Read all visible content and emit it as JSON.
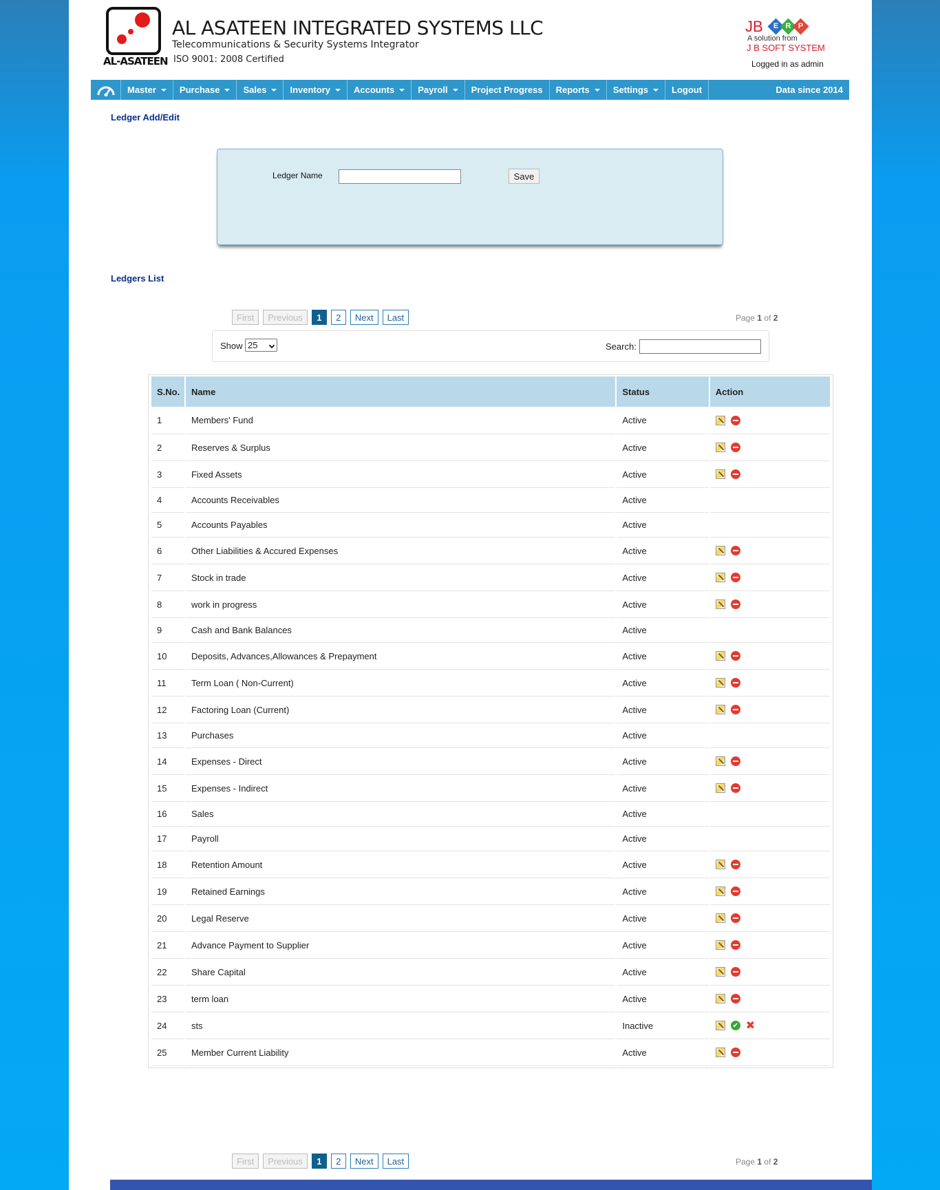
{
  "header": {
    "logo_word": "AL-ASATEEN",
    "company_name": "AL ASATEEN INTEGRATED SYSTEMS LLC",
    "tagline": "Telecommunications & Security Systems Integrator",
    "iso": "ISO 9001: 2008 Certified",
    "vendor_logo": {
      "jb": "JB",
      "e": "E",
      "r": "R",
      "p": "P",
      "solution_line": "A solution from",
      "vendor_name": "J B SOFT SYSTEM"
    },
    "logged_in": "Logged in as admin"
  },
  "nav": {
    "home_icon": "dashboard-gauge-icon",
    "items": [
      {
        "label": "Master",
        "dropdown": true
      },
      {
        "label": "Purchase",
        "dropdown": true
      },
      {
        "label": "Sales",
        "dropdown": true
      },
      {
        "label": "Inventory",
        "dropdown": true
      },
      {
        "label": "Accounts",
        "dropdown": true
      },
      {
        "label": "Payroll",
        "dropdown": true
      },
      {
        "label": "Project Progress",
        "dropdown": false
      },
      {
        "label": "Reports",
        "dropdown": true
      },
      {
        "label": "Settings",
        "dropdown": true
      },
      {
        "label": "Logout",
        "dropdown": false
      }
    ],
    "data_since": "Data since 2014"
  },
  "form": {
    "title": "Ledger Add/Edit",
    "ledger_name_label": "Ledger Name",
    "ledger_name_value": "",
    "save_label": "Save"
  },
  "list": {
    "title": "Ledgers List",
    "pager": {
      "first": "First",
      "previous": "Previous",
      "pages": [
        "1",
        "2"
      ],
      "current_page": "1",
      "next": "Next",
      "last": "Last",
      "page_word": "Page",
      "current": "1",
      "of_word": "of",
      "total": "2"
    },
    "show_label": "Show",
    "show_value": "25",
    "search_label": "Search:",
    "search_value": "",
    "columns": [
      "S.No.",
      "Name",
      "Status",
      "Action"
    ],
    "rows": [
      {
        "sn": "1",
        "name": "Members' Fund",
        "status": "Active",
        "actions": [
          "edit",
          "delete"
        ]
      },
      {
        "sn": "2",
        "name": "Reserves & Surplus",
        "status": "Active",
        "actions": [
          "edit",
          "delete"
        ]
      },
      {
        "sn": "3",
        "name": "Fixed Assets",
        "status": "Active",
        "actions": [
          "edit",
          "delete"
        ]
      },
      {
        "sn": "4",
        "name": "Accounts Receivables",
        "status": "Active",
        "actions": []
      },
      {
        "sn": "5",
        "name": "Accounts Payables",
        "status": "Active",
        "actions": []
      },
      {
        "sn": "6",
        "name": "Other Liabilities & Accured Expenses",
        "status": "Active",
        "actions": [
          "edit",
          "delete"
        ]
      },
      {
        "sn": "7",
        "name": "Stock in trade",
        "status": "Active",
        "actions": [
          "edit",
          "delete"
        ]
      },
      {
        "sn": "8",
        "name": "work in progress",
        "status": "Active",
        "actions": [
          "edit",
          "delete"
        ]
      },
      {
        "sn": "9",
        "name": "Cash and Bank Balances",
        "status": "Active",
        "actions": []
      },
      {
        "sn": "10",
        "name": "Deposits, Advances,Allowances & Prepayment",
        "status": "Active",
        "actions": [
          "edit",
          "delete"
        ]
      },
      {
        "sn": "11",
        "name": "Term Loan ( Non-Current)",
        "status": "Active",
        "actions": [
          "edit",
          "delete"
        ]
      },
      {
        "sn": "12",
        "name": "Factoring Loan (Current)",
        "status": "Active",
        "actions": [
          "edit",
          "delete"
        ]
      },
      {
        "sn": "13",
        "name": "Purchases",
        "status": "Active",
        "actions": []
      },
      {
        "sn": "14",
        "name": "Expenses - Direct",
        "status": "Active",
        "actions": [
          "edit",
          "delete"
        ]
      },
      {
        "sn": "15",
        "name": "Expenses - Indirect",
        "status": "Active",
        "actions": [
          "edit",
          "delete"
        ]
      },
      {
        "sn": "16",
        "name": "Sales",
        "status": "Active",
        "actions": []
      },
      {
        "sn": "17",
        "name": "Payroll",
        "status": "Active",
        "actions": []
      },
      {
        "sn": "18",
        "name": "Retention Amount",
        "status": "Active",
        "actions": [
          "edit",
          "delete"
        ]
      },
      {
        "sn": "19",
        "name": "Retained Earnings",
        "status": "Active",
        "actions": [
          "edit",
          "delete"
        ]
      },
      {
        "sn": "20",
        "name": "Legal Reserve",
        "status": "Active",
        "actions": [
          "edit",
          "delete"
        ]
      },
      {
        "sn": "21",
        "name": "Advance Payment to Supplier",
        "status": "Active",
        "actions": [
          "edit",
          "delete"
        ]
      },
      {
        "sn": "22",
        "name": "Share Capital",
        "status": "Active",
        "actions": [
          "edit",
          "delete"
        ]
      },
      {
        "sn": "23",
        "name": "term loan",
        "status": "Active",
        "actions": [
          "edit",
          "delete"
        ]
      },
      {
        "sn": "24",
        "name": "sts",
        "status": "Inactive",
        "actions": [
          "edit",
          "activate",
          "remove"
        ]
      },
      {
        "sn": "25",
        "name": "Member Current Liability",
        "status": "Active",
        "actions": [
          "edit",
          "delete"
        ]
      }
    ]
  },
  "colors": {
    "nav_bg": "#2e97cc",
    "header_row": "#b9d9ea",
    "title": "#0b2f8c",
    "current_page": "#10608f"
  }
}
